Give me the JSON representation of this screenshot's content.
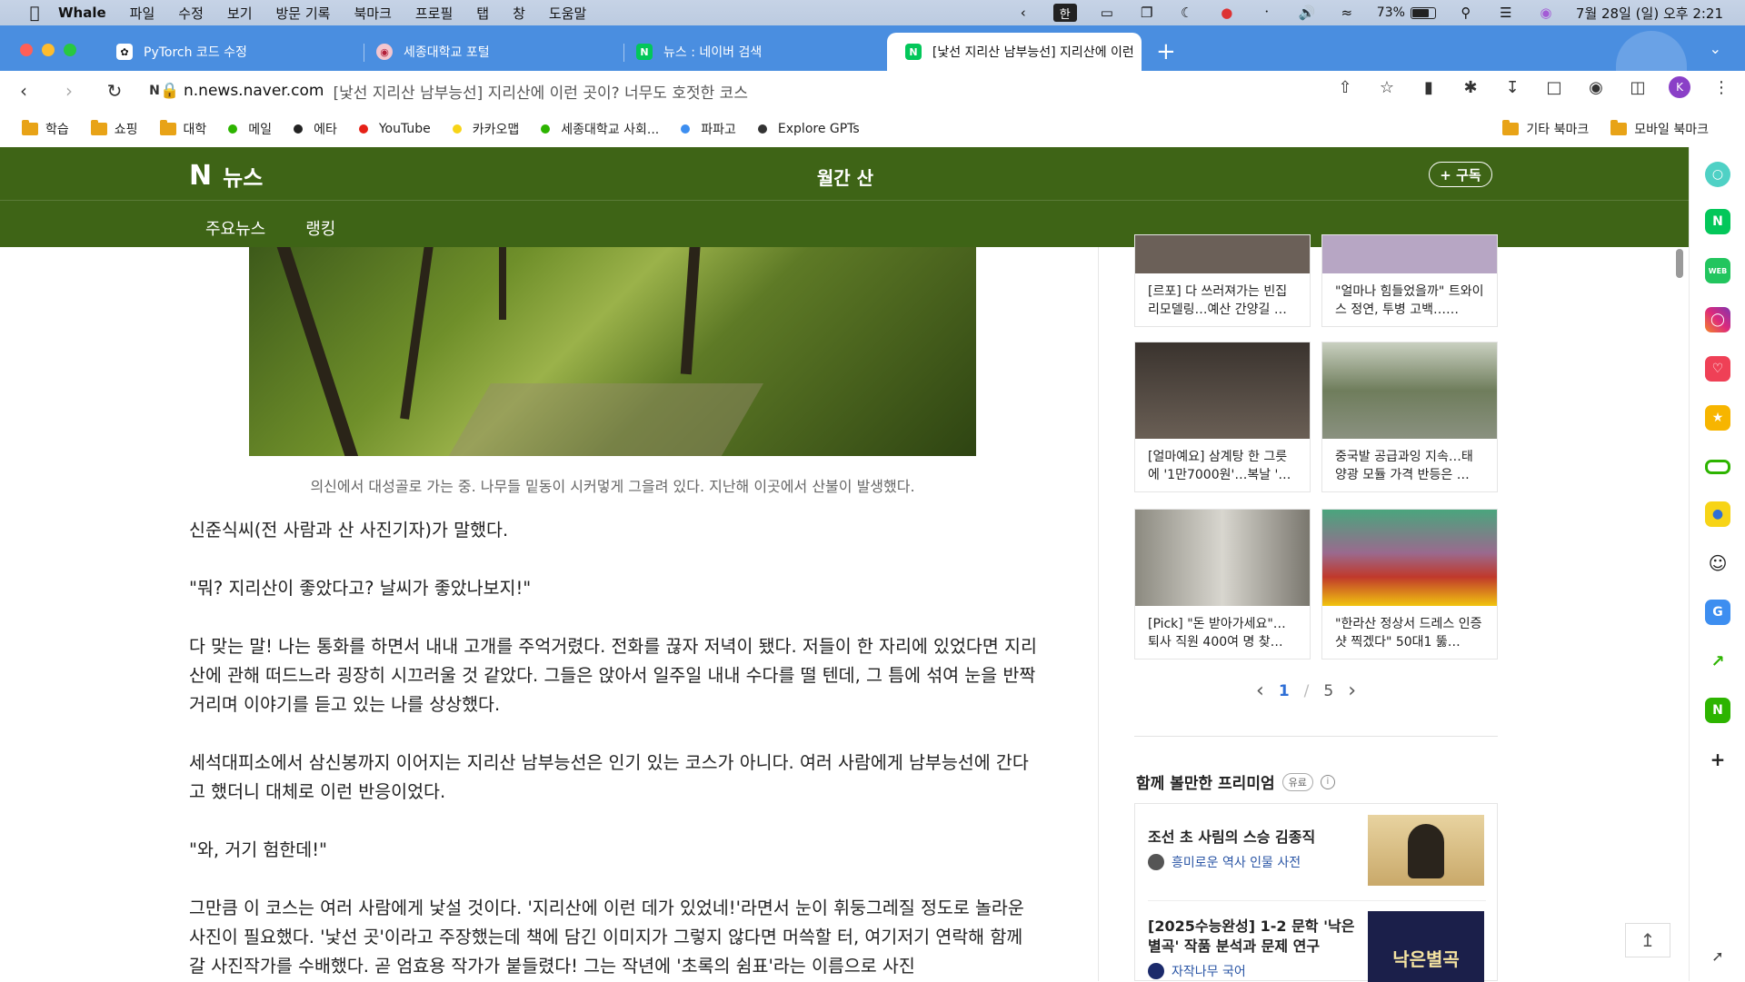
{
  "menubar": {
    "app": "Whale",
    "items": [
      "파일",
      "수정",
      "보기",
      "방문 기록",
      "북마크",
      "프로필",
      "탭",
      "창",
      "도움말"
    ],
    "input_mode": "한",
    "battery": "73%",
    "datetime": "7월 28일 (일) 오후 2:21"
  },
  "tabs": [
    {
      "title": "PyTorch 코드 수정",
      "favicon": "chatgpt-icon"
    },
    {
      "title": "세종대학교 포털",
      "favicon": "sejong-icon"
    },
    {
      "title": "뉴스 : 네이버 검색",
      "favicon": "naver-icon"
    },
    {
      "title": "[낯선 지리산 남부능선] 지리산에 이런",
      "favicon": "naver-icon"
    }
  ],
  "address": {
    "host": "n.news.naver.com",
    "title": "[낯선 지리산 남부능선] 지리산에 이런 곳이? 너무도 호젓한 코스"
  },
  "profile_initial": "K",
  "bookmarks": {
    "left": [
      {
        "label": "학습",
        "type": "folder"
      },
      {
        "label": "쇼핑",
        "type": "folder"
      },
      {
        "label": "대학",
        "type": "folder"
      },
      {
        "label": "메일",
        "type": "dot",
        "color": "#2db400"
      },
      {
        "label": "에타",
        "type": "dot",
        "color": "#222222"
      },
      {
        "label": "YouTube",
        "type": "dot",
        "color": "#e62117"
      },
      {
        "label": "카카오맵",
        "type": "dot",
        "color": "#f7d417"
      },
      {
        "label": "세종대학교 사회...",
        "type": "dot",
        "color": "#2db400"
      },
      {
        "label": "파파고",
        "type": "dot",
        "color": "#3d8ef0"
      },
      {
        "label": "Explore GPTs",
        "type": "dot",
        "color": "#333333"
      }
    ],
    "right": [
      {
        "label": "기타 북마크"
      },
      {
        "label": "모바일 북마크"
      }
    ]
  },
  "naver": {
    "logo": "뉴스",
    "press": "월간 산",
    "subscribe": "+ 구독",
    "menu": [
      "주요뉴스",
      "랭킹"
    ],
    "brand_color": "#3e6416"
  },
  "article": {
    "caption": "의신에서 대성골로 가는 중. 나무들 밑동이 시커멓게 그을려 있다. 지난해 이곳에서 산불이 발생했다.",
    "paragraphs": [
      "신준식씨(전 사람과 산 사진기자)가 말했다.",
      "\"뭐? 지리산이 좋았다고? 날씨가 좋았나보지!\"",
      "다 맞는 말! 나는 통화를 하면서 내내 고개를 주억거렸다. 전화를 끊자 저녁이 됐다. 저들이 한 자리에 있었다면 지리산에 관해 떠드느라 굉장히 시끄러울 것 같았다. 그들은 앉아서 일주일 내내 수다를 떨 텐데, 그 틈에 섞여 눈을 반짝거리며 이야기를 듣고 있는 나를 상상했다.",
      "세석대피소에서 삼신봉까지 이어지는 지리산 남부능선은 인기 있는 코스가 아니다. 여러 사람에게 남부능선에 간다고 했더니 대체로 이런 반응이었다.",
      "\"와, 거기 험한데!\"",
      "그만큼 이 코스는 여러 사람에게 낯설 것이다. '지리산에 이런 데가 있었네!'라면서 눈이 휘둥그레질 정도로 놀라운 사진이 필요했다. '낯선 곳'이라고 주장했는데 책에 담긴 이미지가 그렇지 않다면 머쓱할 터, 여기저기 연락해 함께 갈 사진작가를 수배했다. 곧 엄효용 작가가 붙들렸다! 그는 작년에 '초록의 쉼표'라는 이름으로 사진"
    ]
  },
  "related": [
    {
      "text": "[르포] 다 쓰러져가는 빈집 리모델링…예산 간양길 …",
      "thumb": "#6b6058"
    },
    {
      "text": "\"얼마나 힘들었을까\" 트와이스 정연, 투병 고백……",
      "thumb": "#b7a6c4"
    },
    {
      "text": "[얼마예요] 삼계탕 한 그릇에 '1만7000원'…복날 '…",
      "thumb": "#4a4038"
    },
    {
      "text": "중국발 공급과잉 지속…태양광 모듈 가격 반등은 …",
      "thumb": "#7d8a6a"
    },
    {
      "text": "[Pick] \"돈 받아가세요\"…퇴사 직원 400여 명 찾…",
      "thumb": "#8c8a80"
    },
    {
      "text": "\"한라산 정상서 드레스 인증샷 찍겠다\" 50대1 뚫…",
      "thumb": "#9a6a8e"
    }
  ],
  "pager": {
    "current": "1",
    "sep": "/",
    "total": "5"
  },
  "premium": {
    "title": "함께 볼만한 프리미엄",
    "badge": "유료",
    "items": [
      {
        "title": "조선 초 사림의 스승 김종직",
        "source": "흥미로운 역사 인물 사전"
      },
      {
        "title": "[2025수능완성] 1-2 문학 '낙은별곡' 작품 분석과 문제 연구",
        "source": "자작나무 국어",
        "img_text": "낙은별곡"
      }
    ]
  },
  "sidebar_icons": [
    "whale-space-icon",
    "naver-icon",
    "webtoon-icon",
    "instagram-icon",
    "pocket-icon",
    "favorites-icon",
    "battery-tool-icon",
    "map-pin-icon",
    "smile-icon",
    "translate-icon",
    "stock-icon",
    "naver-store-icon",
    "add-icon",
    "pin-icon"
  ]
}
